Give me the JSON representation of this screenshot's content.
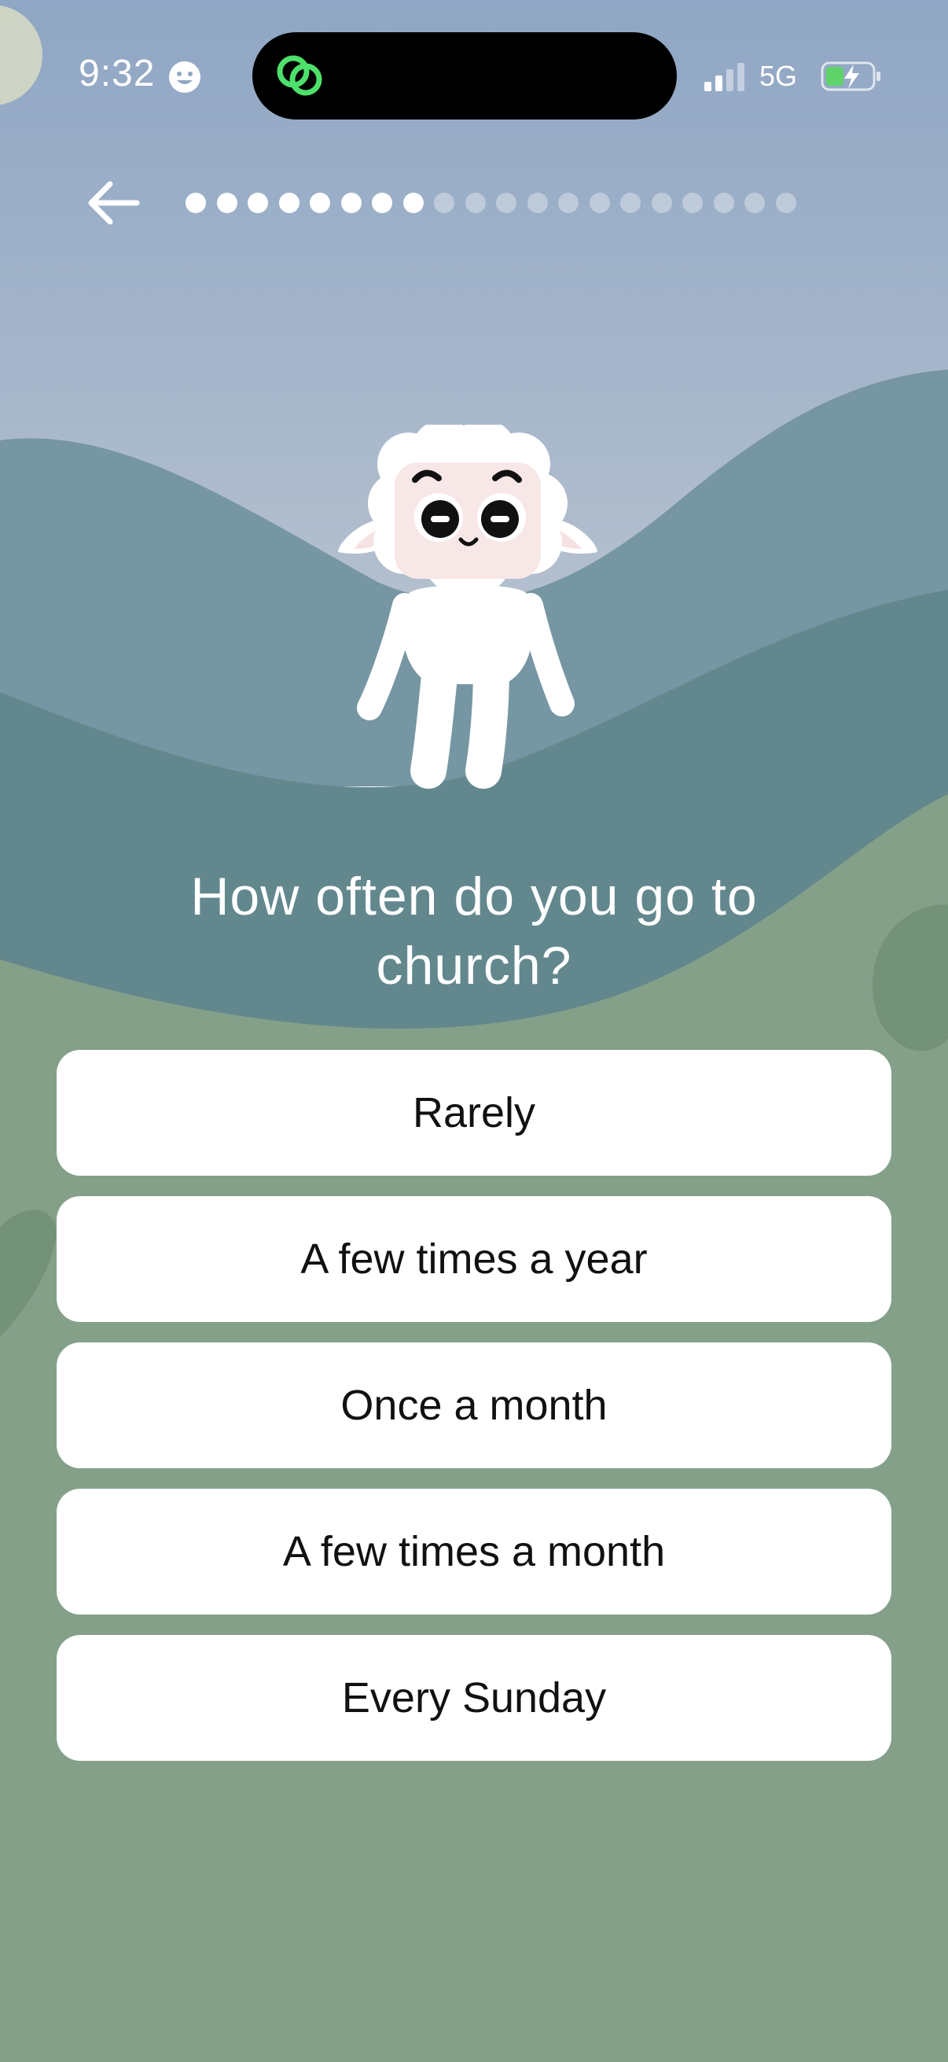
{
  "status_bar": {
    "time": "9:32",
    "network": "5G",
    "time_icon": "smiley-face-icon",
    "island_icon": "linked-rings-icon",
    "signal_icon": "cellular-signal-icon",
    "battery_icon": "charging-battery-icon"
  },
  "navigation": {
    "back_icon": "arrow-left-icon"
  },
  "progress": {
    "total_steps": 20,
    "completed_steps": 8,
    "fraction": 0.4
  },
  "question": {
    "line1": "How often do you go to",
    "line2": "church?"
  },
  "options": [
    "Rarely",
    "A few times a year",
    "Once a month",
    "A few times a month",
    "Every Sunday"
  ],
  "colors": {
    "sky_top": "#8FA6C4",
    "sky_bottom": "#B7C2CF",
    "hill_far": "#7596A2",
    "hill_mid": "#62888E",
    "meadow": "#84A089",
    "button_bg": "#FFFFFF",
    "text_on_button": "#111111",
    "island_icon_green": "#4DE06A"
  }
}
